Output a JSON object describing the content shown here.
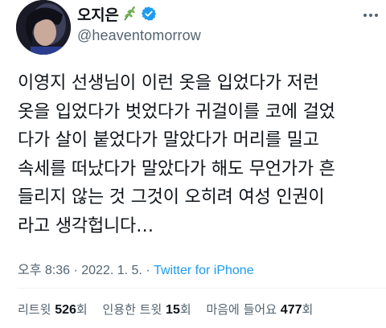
{
  "tweet": {
    "author": {
      "display_name": "오지은",
      "name_emoji": "herb-emoji",
      "verified_icon": "verified-badge-icon",
      "handle": "@heaventomorrow"
    },
    "more_icon": "ellipsis-icon",
    "text": "이영지 선생님이 이런 옷을 입었다가 저런\n옷을 입었다가 벗었다가 귀걸이를 코에 걸었\n다가 살이 붙었다가 말았다가 머리를 밀고\n속세를 떠났다가 말았다가 해도 무언가가 흔\n들리지 않는 것 그것이 오히려 여성 인권이\n라고 생각헙니다…",
    "meta": {
      "time": "오후 8:36",
      "separator": " · ",
      "date": "2022. 1. 5.",
      "separator2": " · ",
      "source": "Twitter for iPhone"
    },
    "stats": {
      "retweets_label": "리트윗",
      "retweets_count": "526",
      "retweets_unit": "회",
      "quotes_label": "인용한 트윗",
      "quotes_count": "15",
      "quotes_unit": "회",
      "likes_label": "마음에 들어요",
      "likes_count": "477",
      "likes_unit": "회"
    },
    "colors": {
      "text": "#0f1419",
      "secondary": "#536471",
      "link": "#1d9bf0",
      "verified": "#1d9bf0",
      "divider": "#eff3f4"
    }
  }
}
